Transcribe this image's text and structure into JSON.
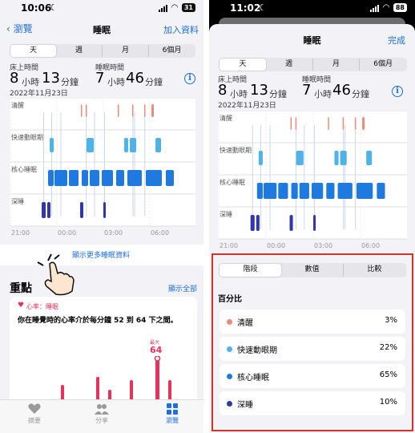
{
  "left": {
    "status": {
      "time": "10:06",
      "battery": "31"
    },
    "nav": {
      "back_label": "瀏覽",
      "title": "睡眠",
      "add_label": "加入資料"
    },
    "segments": [
      {
        "label": "天",
        "selected": true
      },
      {
        "label": "週",
        "selected": false
      },
      {
        "label": "月",
        "selected": false
      },
      {
        "label": "6個月",
        "selected": false
      }
    ],
    "summary": {
      "bed_label": "床上時間",
      "bed_hours": "8",
      "bed_minutes": "13",
      "asleep_label": "睡眠時間",
      "asleep_hours": "7",
      "asleep_minutes": "46",
      "hour_unit": "小時",
      "minute_unit": "分鐘",
      "date": "2022年11月23日",
      "info_icon": "info-icon"
    },
    "chart_data": {
      "type": "bar",
      "stages": [
        "清醒",
        "快速動眼期",
        "核心睡眠",
        "深睡"
      ],
      "x_ticks": [
        "21:00",
        "00:00",
        "03:00",
        "06:00"
      ],
      "colors": {
        "awake": "#f08a7a",
        "rem": "#4fb3e8",
        "core": "#1f7ae0",
        "deep": "#3236a8"
      }
    },
    "more_link": "顯示更多睡眠資料",
    "highlights": {
      "title": "重點",
      "show_all": "顯示全部",
      "card_tag": "心率：睡眠",
      "card_text": "你在睡覺時的心率介於每分鐘 52 到 64 下之間。",
      "max_label": "最大",
      "max_value": "64"
    },
    "tabs": [
      {
        "label": "摘要",
        "icon": "heart-icon"
      },
      {
        "label": "分享",
        "icon": "people-icon"
      },
      {
        "label": "瀏覽",
        "icon": "grid-icon"
      }
    ]
  },
  "right": {
    "status": {
      "time": "11:02",
      "battery": "88"
    },
    "nav": {
      "title": "睡眠",
      "done_label": "完成"
    },
    "segments": [
      {
        "label": "天",
        "selected": true
      },
      {
        "label": "週",
        "selected": false
      },
      {
        "label": "月",
        "selected": false
      },
      {
        "label": "6個月",
        "selected": false
      }
    ],
    "summary": {
      "bed_label": "床上時間",
      "bed_hours": "8",
      "bed_minutes": "13",
      "asleep_label": "睡眠時間",
      "asleep_hours": "7",
      "asleep_minutes": "46",
      "hour_unit": "小時",
      "minute_unit": "分鐘",
      "date": "2022年11月23日"
    },
    "chart_data": {
      "type": "bar",
      "stages": [
        "清醒",
        "快速動眼期",
        "核心睡眠",
        "深睡"
      ],
      "x_ticks": [
        "21:00",
        "00:00",
        "03:00",
        "06:00"
      ]
    },
    "bottom_segments": [
      {
        "label": "階段",
        "selected": true
      },
      {
        "label": "數值",
        "selected": false
      },
      {
        "label": "比較",
        "selected": false
      }
    ],
    "percent_title": "百分比",
    "percent_rows": [
      {
        "name": "清醒",
        "value": "3%",
        "color": "#f08a7a"
      },
      {
        "name": "快速動眼期",
        "value": "22%",
        "color": "#4fb3e8"
      },
      {
        "name": "核心睡眠",
        "value": "65%",
        "color": "#1f7ae0"
      },
      {
        "name": "深睡",
        "value": "10%",
        "color": "#3236a8"
      }
    ]
  }
}
